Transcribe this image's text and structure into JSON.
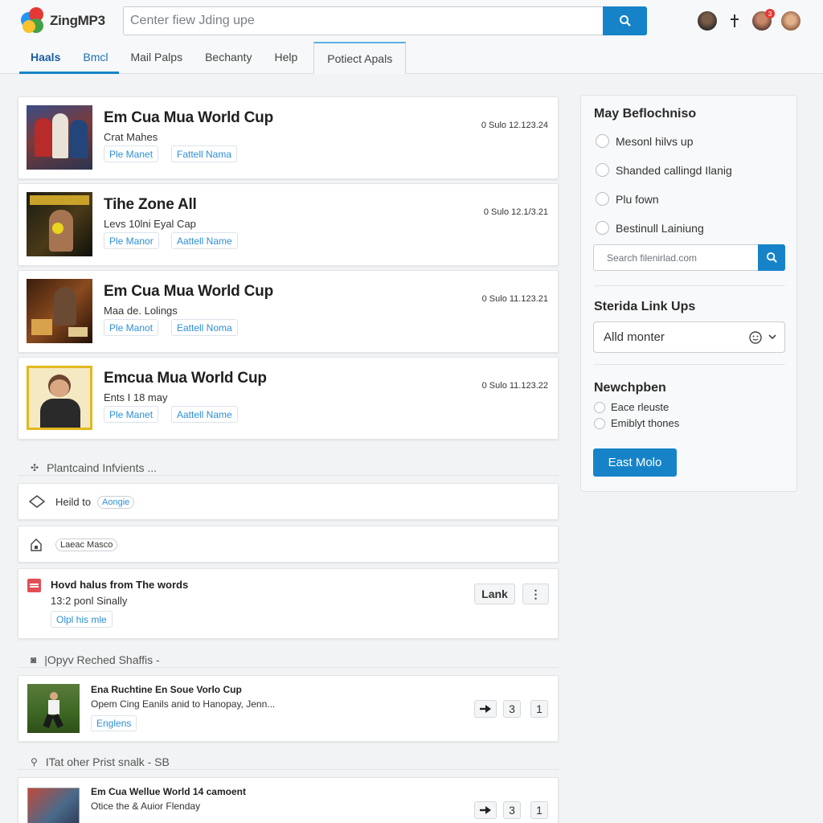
{
  "app": {
    "name": "ZingMP3"
  },
  "search": {
    "placeholder": "Center fiew Jding upe"
  },
  "tabs": [
    {
      "label": "Haals"
    },
    {
      "label": "Bmcl"
    },
    {
      "label": "Mail Palps"
    },
    {
      "label": "Bechanty"
    },
    {
      "label": "Help"
    },
    {
      "label": "Potiect Apals"
    }
  ],
  "header": {
    "badge_count": "3"
  },
  "songs": [
    {
      "title": "Em Cua Mua World Cup",
      "subtitle": "Crat Mahes",
      "tag1": "Ple Manet",
      "tag2": "Fattell Nama",
      "meta": "0 Sulo 12.123.24"
    },
    {
      "title": "Tihe Zone All",
      "subtitle": "Levs 10lni Eyal Cap",
      "tag1": "Ple Manor",
      "tag2": "Aattell Name",
      "meta": "0 Sulo 12.1/3.21"
    },
    {
      "title": "Em Cua Mua World Cup",
      "subtitle": "Maa de. Lolings",
      "tag1": "Ple Manot",
      "tag2": "Eattell Noma",
      "meta": "0 Sulo 11.123.21"
    },
    {
      "title": "Emcua Mua World Cup",
      "subtitle": "Ents I 18 may",
      "tag1": "Ple Manet",
      "tag2": "Aattell Name",
      "meta": "0 Sulo 11.123.22"
    }
  ],
  "section1": {
    "title": "Plantcaind Infvients ...",
    "row1_label": "Heild to",
    "row1_pill": "Aongie",
    "row2_pill": "Laeac Masco"
  },
  "feature": {
    "title": "Hovd halus from The words",
    "subtitle": "13:2 ponl Sinally",
    "link": "Olpl his mle",
    "button": "Lank",
    "more": "⋮"
  },
  "section2": {
    "title": "|Opyv Reched Shaffis -",
    "item_title": "Ena Ruchtine En Soue Vorlo Cup",
    "item_sub": "Opem Cing Eanils anid to Hanopay, Jenn...",
    "item_tag": "Englens",
    "count_a": "3",
    "count_b": "1"
  },
  "section3": {
    "title": "ITat oher Prist snalk - SB",
    "item_title": "Em Cua Wellue World 14 camoent",
    "item_sub": "Otice the & Auior Flenday",
    "count_a": "3",
    "count_b": "1"
  },
  "sidebar": {
    "heading1": "May Beflochniso",
    "options1": [
      "Mesonl hilvs up",
      "Shanded callingd Ilanig",
      "Plu fown",
      "Bestinull Lainiung"
    ],
    "search_placeholder": "Search filenirlad.com",
    "heading2": "Sterida Link Ups",
    "dropdown_value": "Alld monter",
    "heading3": "Newchpben",
    "options2": [
      "Eace rleuste",
      "Emiblyt thones"
    ],
    "button": "East Molo"
  },
  "colors": {
    "accent": "#1683c9",
    "badge": "#e53935"
  }
}
